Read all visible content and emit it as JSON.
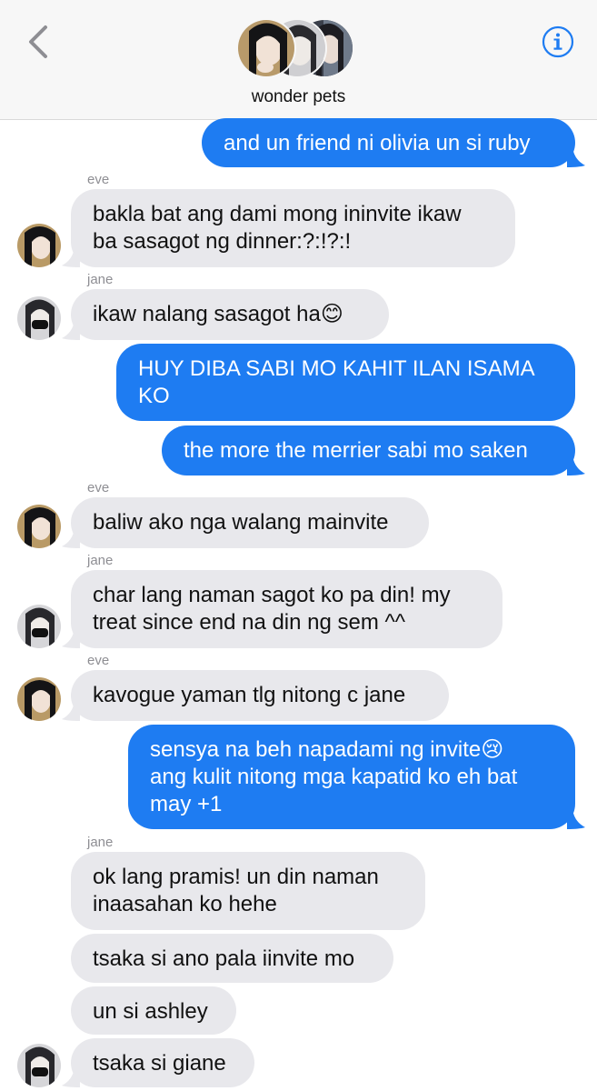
{
  "header": {
    "group_name": "wonder pets",
    "back_icon": "chevron-left-icon",
    "info_icon": "info-icon",
    "accent": "#1e7cf2"
  },
  "messages": [
    {
      "from": "me",
      "text": "and un friend ni olivia un si ruby"
    },
    {
      "from": "eve",
      "sender_label": "eve",
      "text": "bakla bat ang dami mong ininvite ikaw\nba sasagot ng dinner:?:!?:!"
    },
    {
      "from": "jane",
      "sender_label": "jane",
      "text": "ikaw nalang sasagot ha😊"
    },
    {
      "from": "me",
      "text": "HUY DIBA SABI MO KAHIT ILAN ISAMA\nKO"
    },
    {
      "from": "me",
      "text": "the more the merrier sabi mo saken"
    },
    {
      "from": "eve",
      "sender_label": "eve",
      "text": "baliw ako nga walang mainvite"
    },
    {
      "from": "jane",
      "sender_label": "jane",
      "text": "char lang naman sagot ko pa din! my\ntreat since end na din ng sem ^^"
    },
    {
      "from": "eve",
      "sender_label": "eve",
      "text": "kavogue yaman tlg nitong c jane"
    },
    {
      "from": "me",
      "text": "sensya na beh napadami ng invite😢\nang kulit nitong mga kapatid ko eh bat\nmay +1"
    },
    {
      "from": "jane",
      "sender_label": "jane",
      "text": "ok lang pramis! un din naman\ninaasahan ko hehe"
    },
    {
      "from": "jane",
      "text": "tsaka si ano pala iinvite mo"
    },
    {
      "from": "jane",
      "text": "un si ashley"
    },
    {
      "from": "jane",
      "text": "tsaka si giane"
    }
  ],
  "colors": {
    "outgoing_bubble": "#1e7cf2",
    "incoming_bubble": "#e8e8ec",
    "sender_label": "#8e8e93"
  }
}
